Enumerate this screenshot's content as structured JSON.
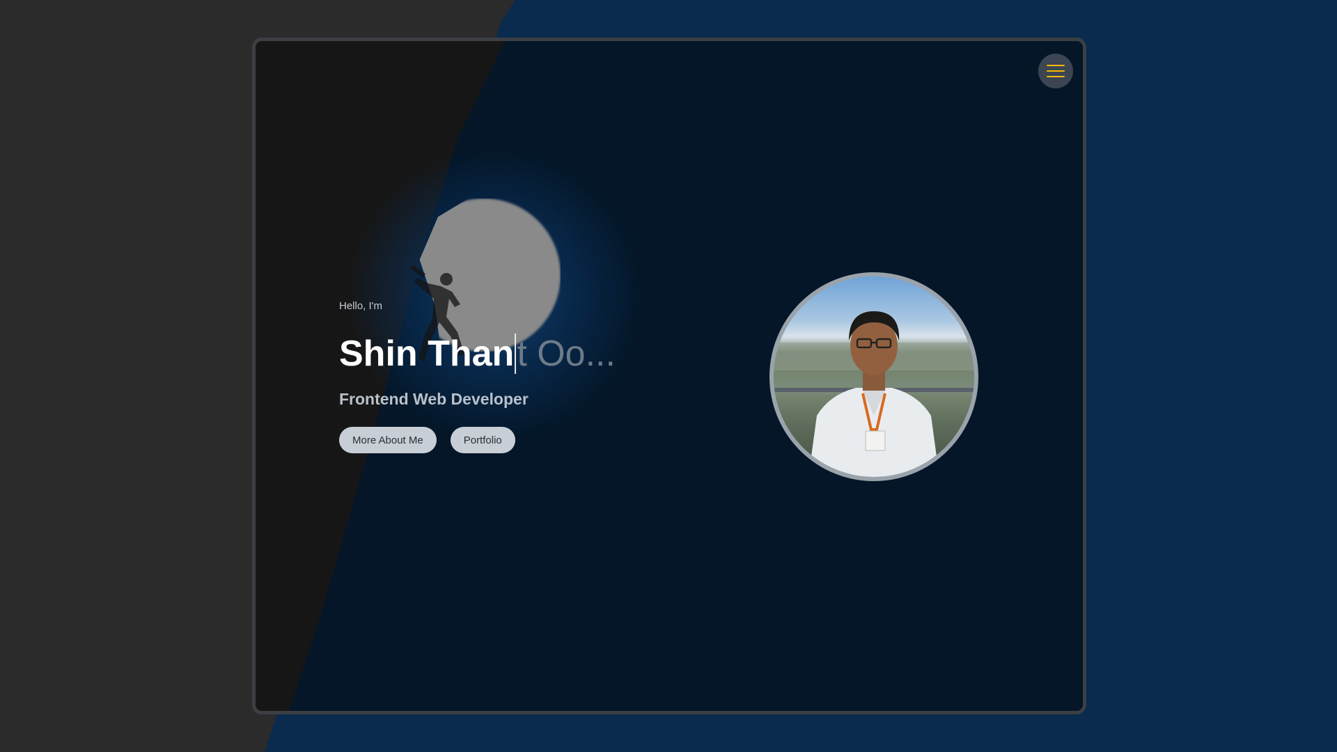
{
  "hero": {
    "greeting": "Hello, I'm",
    "name_typed": "Shin Than",
    "name_rest": "t Oo...",
    "role": "Frontend Web Developer"
  },
  "buttons": {
    "more_about": "More About Me",
    "portfolio": "Portfolio"
  },
  "icons": {
    "menu": "hamburger-menu-icon",
    "avatar": "profile-photo",
    "background": "climber-moon-illustration"
  },
  "colors": {
    "accent": "#f5b800",
    "page_blue": "#0a2a4e",
    "frame_bg": "#041627",
    "pill_bg": "#c8ced5"
  }
}
